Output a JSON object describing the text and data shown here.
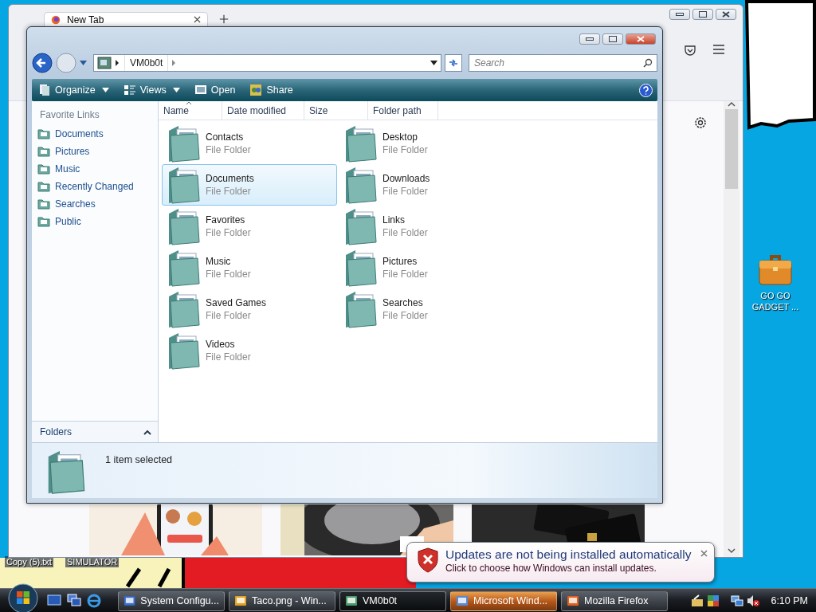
{
  "desktop": {
    "icons": [
      {
        "label": "Copy (5).txt"
      },
      {
        "label": "SIMULATOR"
      },
      {
        "label": "GO GO GADGET ..."
      }
    ]
  },
  "browser": {
    "tabs": [
      {
        "label": "New Tab",
        "selected": true
      }
    ]
  },
  "explorer": {
    "breadcrumb": "VM0b0t",
    "search": {
      "placeholder": "Search"
    },
    "toolbar": [
      {
        "label": "Organize",
        "dropdown": true
      },
      {
        "label": "Views",
        "dropdown": true
      },
      {
        "label": "Open",
        "dropdown": false
      },
      {
        "label": "Share",
        "dropdown": false
      }
    ],
    "sidebar": {
      "title": "Favorite Links",
      "items": [
        {
          "label": "Documents"
        },
        {
          "label": "Pictures"
        },
        {
          "label": "Music"
        },
        {
          "label": "Recently Changed"
        },
        {
          "label": "Searches"
        },
        {
          "label": "Public"
        }
      ],
      "footer": "Folders"
    },
    "columns": [
      {
        "label": "Name",
        "sorted": true
      },
      {
        "label": "Date modified",
        "sorted": false
      },
      {
        "label": "Size",
        "sorted": false
      },
      {
        "label": "Folder path",
        "sorted": false
      }
    ],
    "items": [
      {
        "name": "Contacts",
        "type": "File Folder",
        "selected": false
      },
      {
        "name": "Desktop",
        "type": "File Folder",
        "selected": false
      },
      {
        "name": "Documents",
        "type": "File Folder",
        "selected": true
      },
      {
        "name": "Downloads",
        "type": "File Folder",
        "selected": false
      },
      {
        "name": "Favorites",
        "type": "File Folder",
        "selected": false
      },
      {
        "name": "Links",
        "type": "File Folder",
        "selected": false
      },
      {
        "name": "Music",
        "type": "File Folder",
        "selected": false
      },
      {
        "name": "Pictures",
        "type": "File Folder",
        "selected": false
      },
      {
        "name": "Saved Games",
        "type": "File Folder",
        "selected": false
      },
      {
        "name": "Searches",
        "type": "File Folder",
        "selected": false
      },
      {
        "name": "Videos",
        "type": "File Folder",
        "selected": false
      }
    ],
    "status": "1 item selected"
  },
  "notification": {
    "title": "Updates are not being installed automatically",
    "message": "Click to choose how Windows can install updates."
  },
  "taskbar": {
    "buttons": [
      {
        "label": "System Configu...",
        "selected": false,
        "flashing": false
      },
      {
        "label": "Taco.png - Win...",
        "selected": false,
        "flashing": false
      },
      {
        "label": "VM0b0t",
        "selected": true,
        "flashing": false
      },
      {
        "label": "Microsoft Wind...",
        "selected": false,
        "flashing": true
      },
      {
        "label": "Mozilla Firefox",
        "selected": false,
        "flashing": false
      }
    ],
    "clock": "6:10 PM"
  }
}
